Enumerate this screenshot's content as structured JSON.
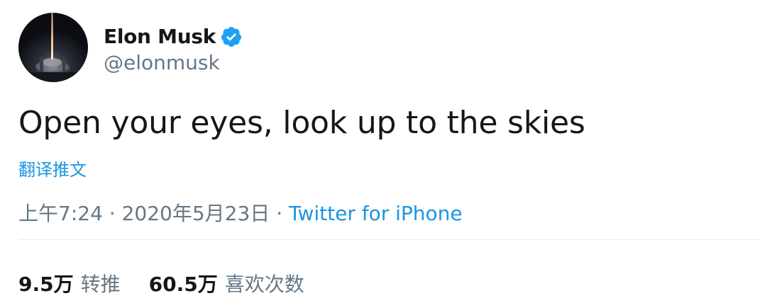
{
  "user": {
    "display_name": "Elon Musk",
    "handle": "@elonmusk",
    "verified": true,
    "avatar_icon": "rocket-launch-night-avatar"
  },
  "tweet": {
    "text": "Open your eyes, look up to the skies",
    "translate_label": "翻译推文"
  },
  "meta": {
    "time": "上午7:24",
    "separator": " · ",
    "date": "2020年5月23日",
    "source": "Twitter for iPhone"
  },
  "stats": {
    "retweets_count": "9.5万",
    "retweets_label": "转推",
    "likes_count": "60.5万",
    "likes_label": "喜欢次数"
  },
  "colors": {
    "text_primary": "#14171a",
    "text_secondary": "#657786",
    "link_blue": "#1b95e0",
    "verified_blue": "#1da1f2",
    "divider": "#e6ecf0"
  }
}
